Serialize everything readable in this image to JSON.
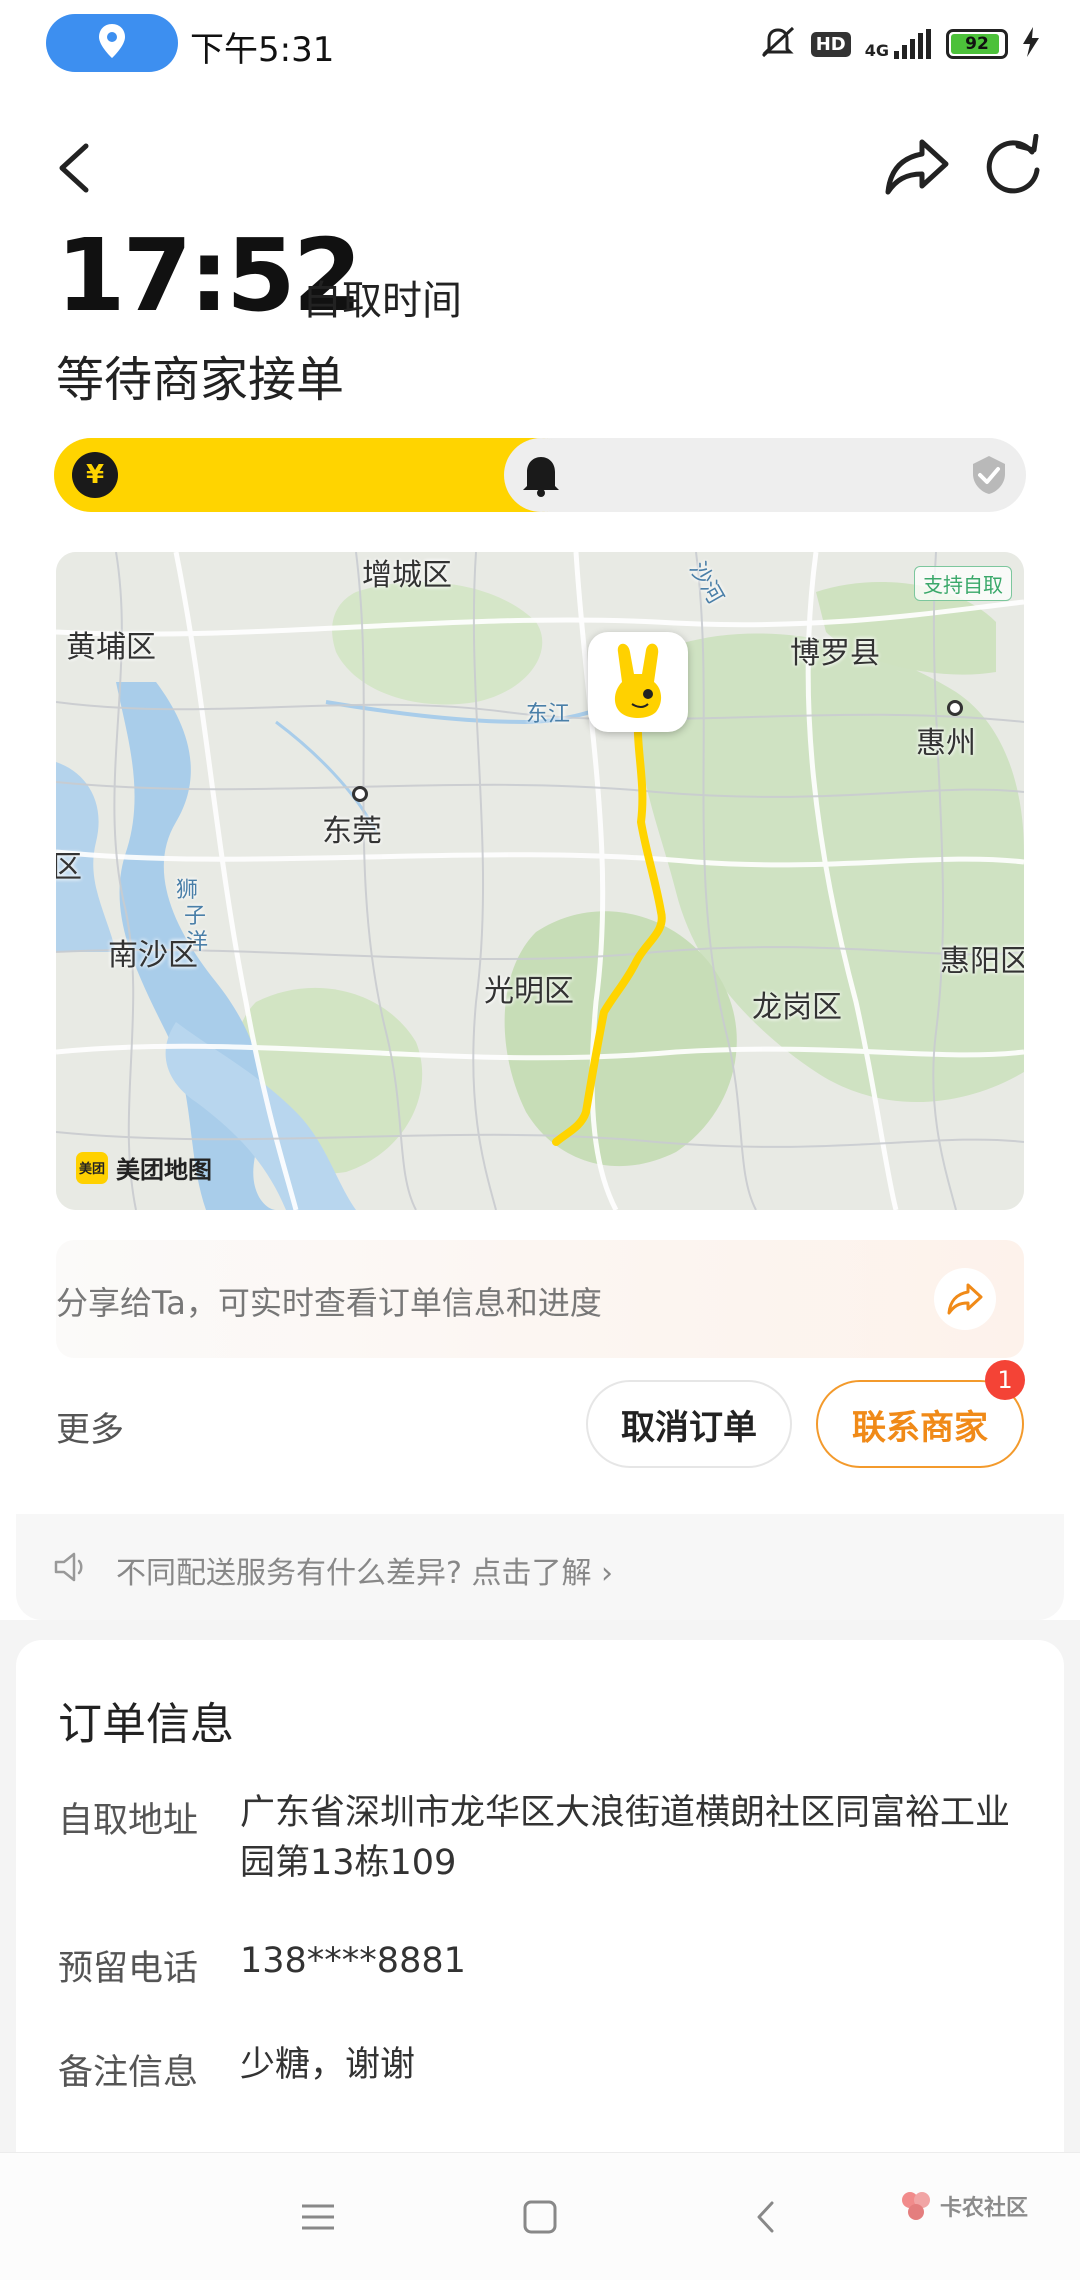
{
  "status_bar": {
    "time": "下午5:31",
    "hd": "HD",
    "network": "4G",
    "battery": "92",
    "battery_level": 0.92
  },
  "header": {
    "pickup_time": "17:52",
    "pickup_time_label": "自取时间",
    "order_status": "等待商家接单"
  },
  "progress": {
    "steps": [
      "paid",
      "notified",
      "done"
    ],
    "current_step": 2,
    "currency_symbol": "¥"
  },
  "map": {
    "pickup_tag": "支持自取",
    "brand_logo": "美团",
    "brand": "美团地图",
    "labels": {
      "zengcheng": "增城区",
      "huangpu": "黄埔区",
      "boluo": "博罗县",
      "huizhou": "惠州",
      "dongguan": "东莞",
      "edge_qu": "区",
      "nansha": "南沙区",
      "guangming": "光明区",
      "longgang": "龙岗区",
      "huiyang": "惠阳区",
      "river_east": "东江",
      "river_sha": "沙河",
      "strait_1": "狮",
      "strait_2": "子",
      "strait_3": "洋"
    }
  },
  "share": {
    "text": "分享给Ta，可实时查看订单信息和进度"
  },
  "actions": {
    "more": "更多",
    "cancel": "取消订单",
    "contact": "联系商家",
    "contact_badge": "1"
  },
  "tips": {
    "text": "不同配送服务有什么差异? 点击了解",
    "chevron": "›"
  },
  "order_info": {
    "title": "订单信息",
    "rows": [
      {
        "label": "自取地址",
        "value": "广东省深圳市龙华区大浪街道横朗社区同富裕工业园第13栋109"
      },
      {
        "label": "预留电话",
        "value": "138****8881"
      },
      {
        "label": "备注信息",
        "value": "少糖，谢谢"
      }
    ]
  },
  "watermark": {
    "text": "卡农社区"
  },
  "colors": {
    "accent_yellow": "#ffd400",
    "contact_orange": "#f08a18",
    "badge_red": "#f44336",
    "location_blue": "#3d8ff0"
  }
}
